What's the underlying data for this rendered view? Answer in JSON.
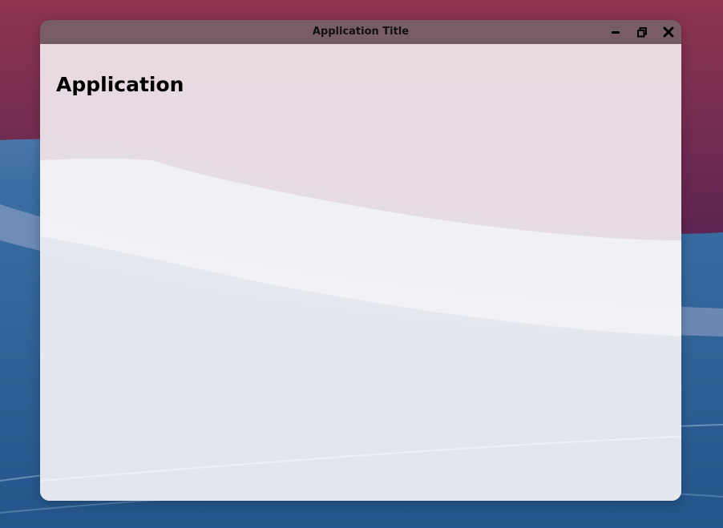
{
  "window": {
    "title": "Application Title",
    "controls": {
      "minimize_icon": "minimize-icon",
      "maximize_icon": "restore-icon",
      "close_icon": "close-icon"
    }
  },
  "content": {
    "heading": "Application"
  },
  "colors": {
    "titlebar": "#766068",
    "client": "#f6f2f6",
    "wallpaper_top": "#8a2f4f",
    "wallpaper_bottom": "#244f82"
  }
}
